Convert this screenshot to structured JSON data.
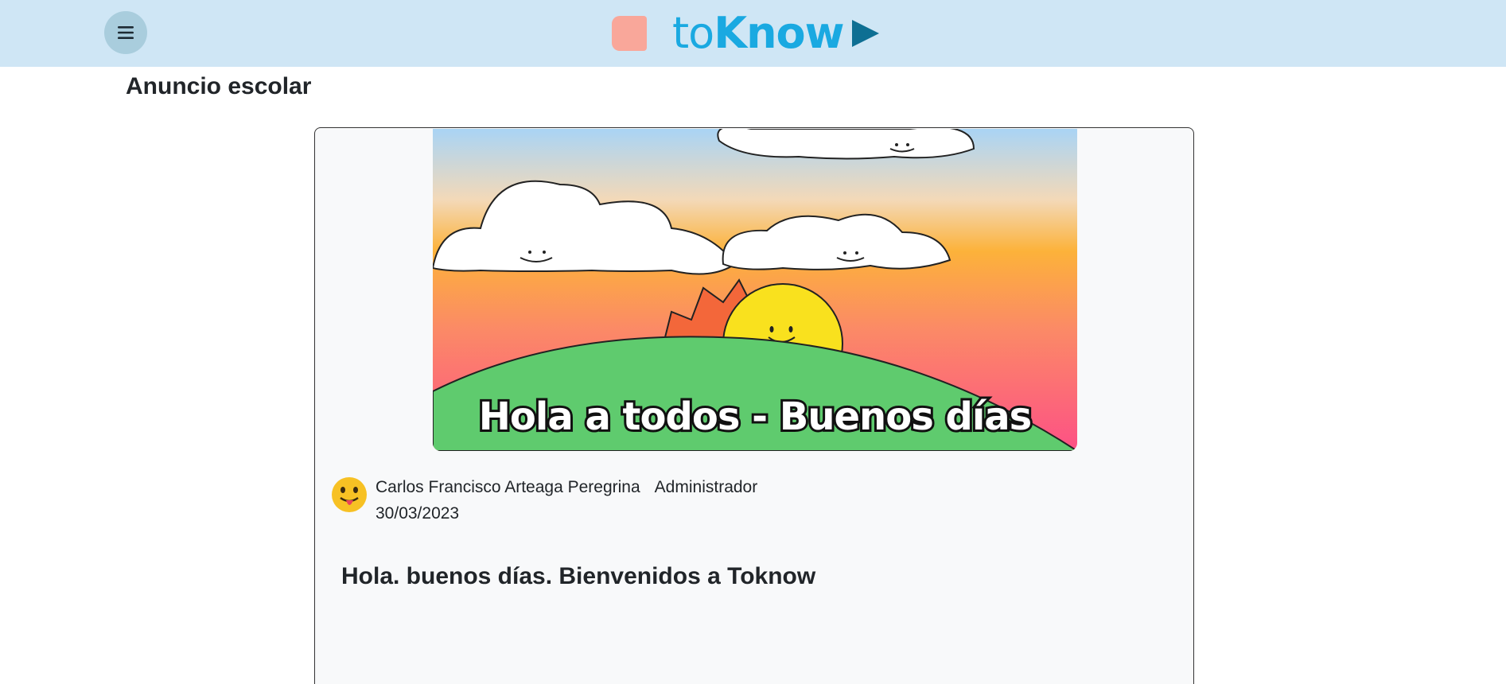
{
  "header": {
    "menu_icon": "hamburger-menu-icon",
    "logo_text_light": "to",
    "logo_text_bold": "Know",
    "colors": {
      "bar": "#cfe6f5",
      "logo_blue": "#1aa9e1",
      "logo_square": "#f9a79a",
      "logo_play": "#0e6f93"
    }
  },
  "page": {
    "title": "Anuncio escolar"
  },
  "post": {
    "image_caption": "Hola a todos - Buenos días",
    "author_name": "Carlos Francisco Arteaga Peregrina",
    "author_role": "Administrador",
    "date": "30/03/2023",
    "body": "Hola. buenos días. Bienvenidos a Toknow",
    "avatar_icon": "tongue-out-emoji-icon"
  }
}
